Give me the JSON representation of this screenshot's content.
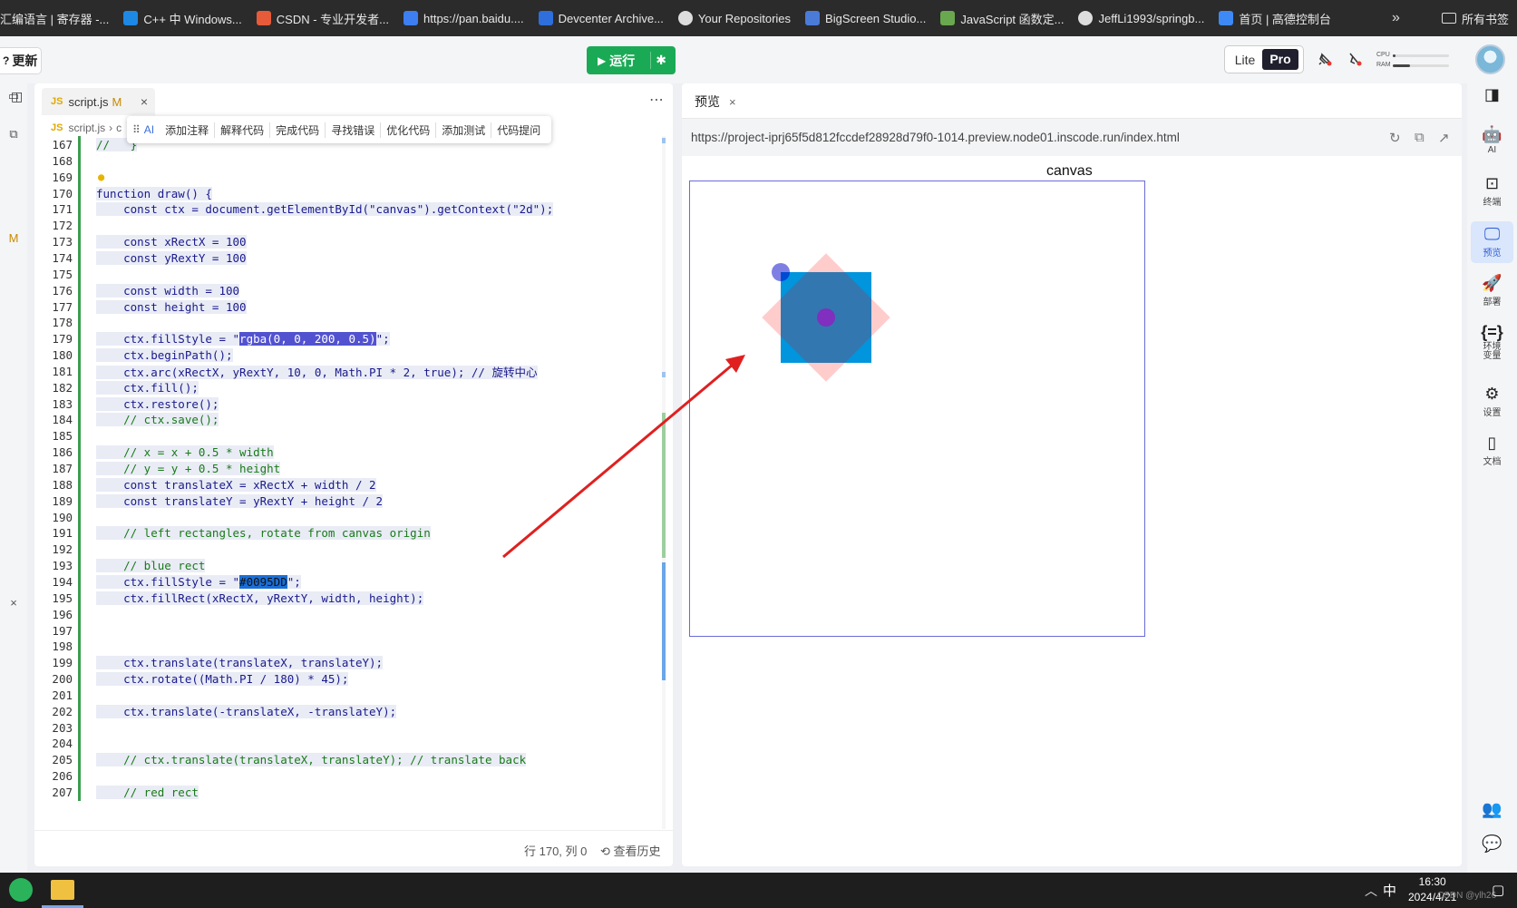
{
  "bookmarks": [
    {
      "label": "汇编语言 | 寄存器 -...",
      "icon": "bookmark-page-icon",
      "color": "#2b2b2b"
    },
    {
      "label": "C++ 中 Windows...",
      "icon": "windows-icon",
      "color": "#1e88e5"
    },
    {
      "label": "CSDN - 专业开发者...",
      "icon": "csdn-icon",
      "color": "#e85b3a"
    },
    {
      "label": "https://pan.baidu....",
      "icon": "baidu-pan-icon",
      "color": "#3d7ef0"
    },
    {
      "label": "Devcenter Archive...",
      "icon": "devcenter-icon",
      "color": "#2f6fdb"
    },
    {
      "label": "Your Repositories",
      "icon": "github-icon",
      "color": "#2b2b2b"
    },
    {
      "label": "BigScreen Studio...",
      "icon": "bigscreen-icon",
      "color": "#4a7bd8"
    },
    {
      "label": "JavaScript 函数定...",
      "icon": "javascript-site-icon",
      "color": "#6aa84f"
    },
    {
      "label": "JeffLi1993/springb...",
      "icon": "github-icon",
      "color": "#2b2b2b"
    },
    {
      "label": "首页 | 高德控制台",
      "icon": "amap-icon",
      "color": "#3d8af7"
    }
  ],
  "bookmarks_more": "»",
  "bookmarks_all": "所有书签",
  "toolbar": {
    "update_label": "更新",
    "run_label": "运行",
    "plan_lite": "Lite",
    "plan_pro": "Pro",
    "cpu_label": "CPU",
    "ram_label": "RAM",
    "cpu_level": 0.05,
    "ram_level": 0.3
  },
  "editor": {
    "tab_name": "script.js",
    "tab_modified": "M",
    "breadcrumb": [
      "script.js",
      "c"
    ],
    "ai_bar": {
      "ai_label": "AI",
      "items": [
        "添加注释",
        "解释代码",
        "完成代码",
        "寻找错误",
        "优化代码",
        "添加测试",
        "代码提问"
      ]
    },
    "left_strip_badge": "M",
    "lines": [
      {
        "n": "167",
        "text": "//   }"
      },
      {
        "n": "168",
        "text": ""
      },
      {
        "n": "169",
        "text": ""
      },
      {
        "n": "170",
        "text": "function draw() {"
      },
      {
        "n": "171",
        "text": "    const ctx = document.getElementById(\"canvas\").getContext(\"2d\");"
      },
      {
        "n": "172",
        "text": ""
      },
      {
        "n": "173",
        "text": "    const xRectX = 100"
      },
      {
        "n": "174",
        "text": "    const yRextY = 100"
      },
      {
        "n": "175",
        "text": ""
      },
      {
        "n": "176",
        "text": "    const width = 100"
      },
      {
        "n": "177",
        "text": "    const height = 100"
      },
      {
        "n": "178",
        "text": ""
      },
      {
        "n": "179",
        "pre": "    ctx.fillStyle = \"",
        "sel": "rgba(0, 0, 200, 0.5)",
        "post": "\";"
      },
      {
        "n": "180",
        "text": "    ctx.beginPath();"
      },
      {
        "n": "181",
        "text": "    ctx.arc(xRectX, yRextY, 10, 0, Math.PI * 2, true); // 旋转中心"
      },
      {
        "n": "182",
        "text": "    ctx.fill();"
      },
      {
        "n": "183",
        "text": "    ctx.restore();"
      },
      {
        "n": "184",
        "text": "    // ctx.save();"
      },
      {
        "n": "185",
        "text": ""
      },
      {
        "n": "186",
        "text": "    // x = x + 0.5 * width"
      },
      {
        "n": "187",
        "text": "    // y = y + 0.5 * height"
      },
      {
        "n": "188",
        "text": "    const translateX = xRectX + width / 2"
      },
      {
        "n": "189",
        "text": "    const translateY = yRextY + height / 2"
      },
      {
        "n": "190",
        "text": ""
      },
      {
        "n": "191",
        "text": "    // left rectangles, rotate from canvas origin"
      },
      {
        "n": "192",
        "text": ""
      },
      {
        "n": "193",
        "text": "    // blue rect"
      },
      {
        "n": "194",
        "pre": "    ctx.fillStyle = \"",
        "sel": "#0095DD",
        "post": "\";"
      },
      {
        "n": "195",
        "text": "    ctx.fillRect(xRectX, yRextY, width, height);"
      },
      {
        "n": "196",
        "text": ""
      },
      {
        "n": "197",
        "text": ""
      },
      {
        "n": "198",
        "text": ""
      },
      {
        "n": "199",
        "text": "    ctx.translate(translateX, translateY);"
      },
      {
        "n": "200",
        "text": "    ctx.rotate((Math.PI / 180) * 45);"
      },
      {
        "n": "201",
        "text": ""
      },
      {
        "n": "202",
        "text": "    ctx.translate(-translateX, -translateY);"
      },
      {
        "n": "203",
        "text": ""
      },
      {
        "n": "204",
        "text": ""
      },
      {
        "n": "205",
        "text": "    // ctx.translate(translateX, translateY); // translate back"
      },
      {
        "n": "206",
        "text": ""
      },
      {
        "n": "207",
        "text": "    // red rect"
      }
    ],
    "status_position": "行 170, 列 0",
    "status_history": "查看历史"
  },
  "preview": {
    "tab_label": "预览",
    "url": "https://project-iprj65f5d812fccdef28928d79f0-1014.preview.node01.inscode.run/index.html",
    "canvas_title": "canvas",
    "colors": {
      "blue_rect": "#0095DD",
      "red_rect": "rgba(255, 0, 0, 0.2)",
      "center_dot": "rgba(0, 0, 200, 0.5)",
      "arrow": "#e02020"
    }
  },
  "right_sidebar": [
    {
      "label": "AI",
      "icon": "robot-icon"
    },
    {
      "label": "终端",
      "icon": "terminal-icon"
    },
    {
      "label": "预览",
      "icon": "monitor-icon",
      "active": true
    },
    {
      "label": "部署",
      "icon": "rocket-icon"
    },
    {
      "label": "环境\n变量",
      "icon": "braces-icon"
    },
    {
      "label": "设置",
      "icon": "settings-icon"
    },
    {
      "label": "文档",
      "icon": "book-icon"
    }
  ],
  "taskbar": {
    "ime": "中",
    "time": "16:30",
    "date": "2024/4/21",
    "watermark": "CSDN @ylh26"
  }
}
